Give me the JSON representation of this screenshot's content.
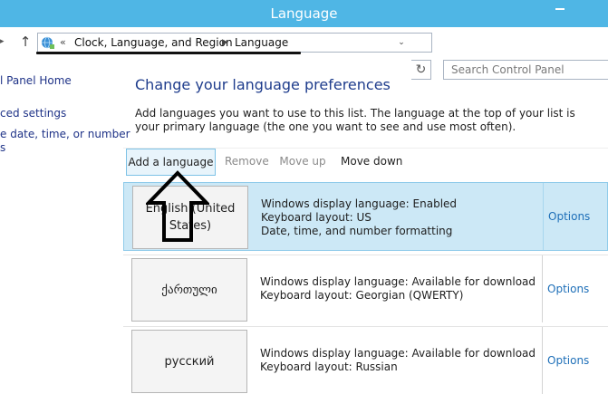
{
  "window": {
    "title": "Language"
  },
  "navigation": {
    "breadcrumb_separator": "«",
    "crumbs": [
      "Clock, Language, and Region",
      "Language"
    ],
    "search_placeholder": "Search Control Panel"
  },
  "sidebar": {
    "home": "l Panel Home",
    "advanced": "ced settings",
    "date_line1": "e date, time, or number",
    "date_line2": "s"
  },
  "main": {
    "heading": "Change your language preferences",
    "description": "Add languages you want to use to this list. The language at the top of your list is your primary language (the one you want to see and use most often)."
  },
  "toolbar": {
    "add": "Add a language",
    "remove": "Remove",
    "move_up": "Move up",
    "move_down": "Move down"
  },
  "languages": [
    {
      "name": "English (United States)",
      "display": "Windows display language: Enabled",
      "keyboard": "Keyboard layout: US",
      "formatting": "Date, time, and number formatting",
      "options": "Options",
      "selected": true
    },
    {
      "name": "ქართული",
      "display": "Windows display language: Available for download",
      "keyboard": "Keyboard layout: Georgian (QWERTY)",
      "options": "Options",
      "selected": false
    },
    {
      "name": "русский",
      "display": "Windows display language: Available for download",
      "keyboard": "Keyboard layout: Russian",
      "options": "Options",
      "selected": false
    }
  ],
  "colors": {
    "titlebar": "#4fb6e5",
    "selected_row": "#cce8f6",
    "link": "#1e6fb8",
    "heading": "#1e3c8c"
  },
  "icons": [
    "minimize-icon",
    "back-arrow-icon",
    "up-arrow-icon",
    "control-panel-globe-icon",
    "chevron-right-icon",
    "dropdown-icon",
    "refresh-icon",
    "up-arrow-annotation"
  ]
}
